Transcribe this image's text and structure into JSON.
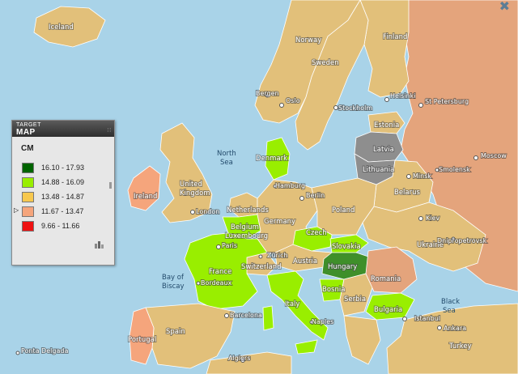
{
  "legend": {
    "brand_top": "TARGET",
    "brand_bottom": "MAP",
    "title": "CM",
    "classes": [
      {
        "range": "16.10 - 17.93",
        "color": "#006400"
      },
      {
        "range": "14.88 - 16.09",
        "color": "#99ee00"
      },
      {
        "range": "13.48 - 14.87",
        "color": "#f7c84e"
      },
      {
        "range": "11.67 - 13.47",
        "color": "#f5a57c"
      },
      {
        "range": "9.66 - 11.66",
        "color": "#ee1111"
      }
    ],
    "selected_index": 3
  },
  "map_colors": {
    "sea": "#a9d3e8",
    "no_data": "#8e8e8e"
  },
  "countries": {
    "iceland": "Iceland",
    "norway": "Norway",
    "sweden": "Sweden",
    "finland": "Finland",
    "estonia": "Estonia",
    "latvia": "Latvia",
    "lithuania": "Lithuania",
    "denmark": "Denmark",
    "ireland": "Ireland",
    "uk_line1": "United",
    "uk_line2": "Kingdom",
    "netherlands": "Netherlands",
    "belgium": "Belgium",
    "luxembourg": "Luxembourg",
    "germany": "Germany",
    "poland": "Poland",
    "belarus": "Belarus",
    "czech": "Czech",
    "slovakia": "Slovakia",
    "austria": "Austria",
    "hungary": "Hungary",
    "switzerland": "Switzerland",
    "france": "France",
    "italy": "Italy",
    "spain": "Spain",
    "portugal": "Portugal",
    "ukraine": "Ukraine",
    "romania": "Romania",
    "bulgaria": "Bulgaria",
    "serbia": "Serbia",
    "bosnia": "Bosnia",
    "turkey": "Turkey"
  },
  "seas": {
    "north_sea_1": "North",
    "north_sea_2": "Sea",
    "biscay_1": "Bay of",
    "biscay_2": "Biscay",
    "black_sea_1": "Black",
    "black_sea_2": "Sea"
  },
  "cities": {
    "oslo": "Oslo",
    "stockholm": "Stockholm",
    "helsinki": "Helsinki",
    "st_petersburg": "St Petersburg",
    "moscow": "Moscow",
    "berlin": "Berlin",
    "hamburg": "Hamburg",
    "amsterdam": "Amsterdam",
    "london": "London",
    "paris": "Paris",
    "bordeaux": "Bordeaux",
    "zurich": "Zürich",
    "barcelona": "Barcelona",
    "kiev": "Kiev",
    "minsk": "Minsk",
    "ankara": "Ankara",
    "istanbul": "Istanbul",
    "algiers": "Algiers",
    "ponta_delgada": "Ponta Delgada",
    "naples": "Naples",
    "bergen": "Bergen",
    "smolensk": "Smolensk",
    "dnipropetrovsk": "Dnipropetrovsk"
  }
}
